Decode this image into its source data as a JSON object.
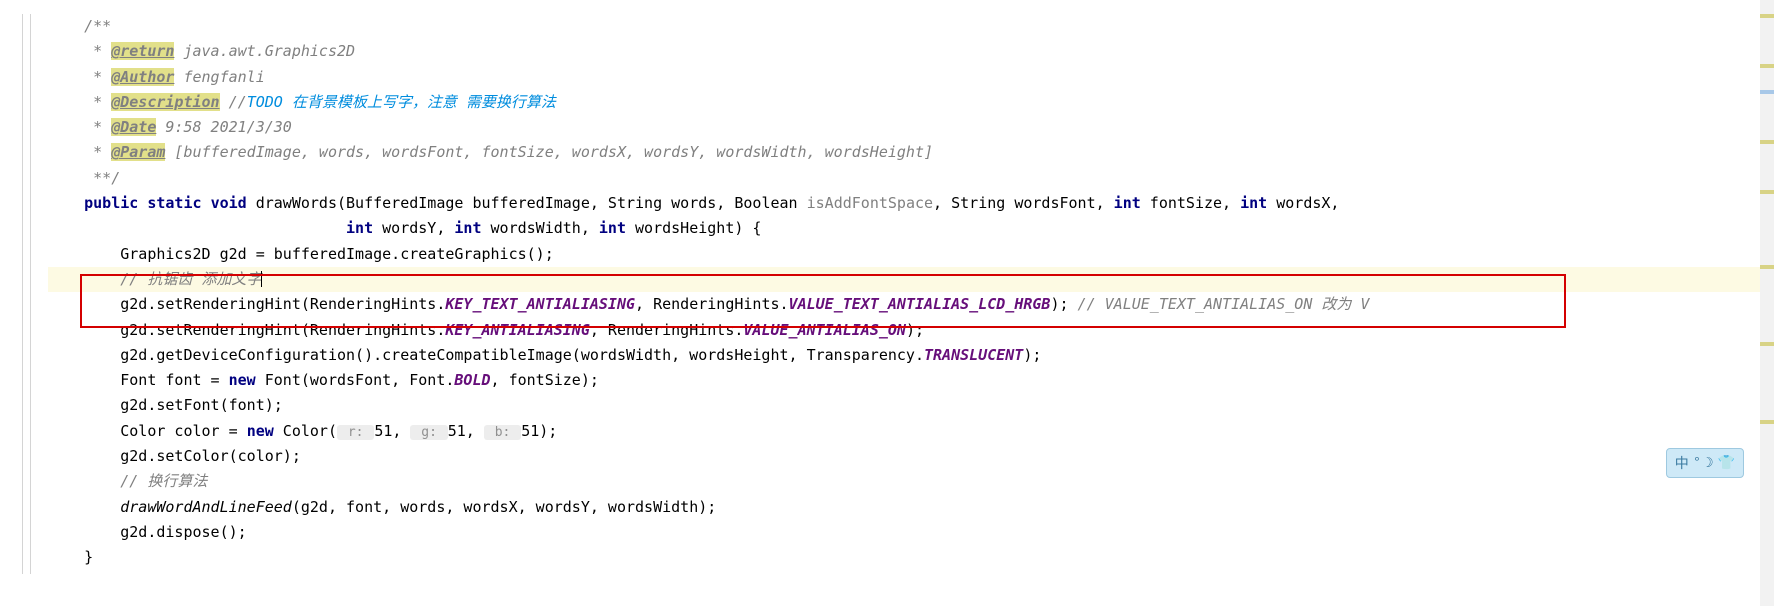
{
  "code": {
    "l0": "    /**",
    "l1_pre": "     * ",
    "l1_tag": "@return",
    "l1_val": " java.awt.Graphics2D",
    "l2_pre": "     * ",
    "l2_tag": "@Author",
    "l2_val": " fengfanli",
    "l3_pre": "     * ",
    "l3_tag": "@Description",
    "l3_slash": " //",
    "l3_todo": "TODO 在背景模板上写字，注意 需要换行算法",
    "l4_pre": "     * ",
    "l4_tag": "@Date",
    "l4_val": " 9:58 2021/3/30",
    "l5_pre": "     * ",
    "l5_tag": "@Param",
    "l5_val": " [bufferedImage, words, wordsFont, fontSize, wordsX, wordsY, wordsWidth, wordsHeight]",
    "l6": "     **/",
    "l7_a": "    ",
    "l7_public": "public",
    "l7_static": "static",
    "l7_void": "void",
    "l7_b": " drawWords(BufferedImage bufferedImage, String words, Boolean ",
    "l7_unused": "isAddFontSpace",
    "l7_c": ", String wordsFont, ",
    "l7_int1": "int",
    "l7_d": " fontSize, ",
    "l7_int2": "int",
    "l7_e": " wordsX,",
    "l8_indent": "                                 ",
    "l8_int1": "int",
    "l8_a": " wordsY, ",
    "l8_int2": "int",
    "l8_b": " wordsWidth, ",
    "l8_int3": "int",
    "l8_c": " wordsHeight) {",
    "l9": "        Graphics2D g2d = bufferedImage.createGraphics();",
    "l10_pre": "        ",
    "l10_comment": "// 抗锯齿 添加文字",
    "l11_a": "        g2d.setRenderingHint(RenderingHints.",
    "l11_key": "KEY_TEXT_ANTIALIASING",
    "l11_b": ", RenderingHints.",
    "l11_val": "VALUE_TEXT_ANTIALIAS_LCD_HRGB",
    "l11_c": "); ",
    "l11_comment": "// VALUE_TEXT_ANTIALIAS_ON 改为 V",
    "l12_a": "        g2d.setRenderingHint(RenderingHints.",
    "l12_key": "KEY_ANTIALIASING",
    "l12_b": ", RenderingHints.",
    "l12_val": "VALUE_ANTIALIAS_ON",
    "l12_c": ");",
    "l13_a": "        g2d.getDeviceConfiguration().createCompatibleImage(wordsWidth, wordsHeight, Transparency.",
    "l13_field": "TRANSLUCENT",
    "l13_b": ");",
    "l14_a": "        Font font = ",
    "l14_new": "new",
    "l14_b": " Font(wordsFont, Font.",
    "l14_field": "BOLD",
    "l14_c": ", fontSize);",
    "l15": "        g2d.setFont(font);",
    "l16_a": "        Color color = ",
    "l16_new": "new",
    "l16_b": " Color(",
    "l16_h1": " r: ",
    "l16_v1": "51, ",
    "l16_h2": " g: ",
    "l16_v2": "51, ",
    "l16_h3": " b: ",
    "l16_v3": "51);",
    "l17": "        g2d.setColor(color);",
    "l18_pre": "        ",
    "l18_comment": "// 换行算法",
    "l19_a": "        ",
    "l19_call": "drawWordAndLineFeed",
    "l19_b": "(g2d, font, words, wordsX, wordsY, wordsWidth);",
    "l20": "        g2d.dispose();",
    "l21": "    }"
  },
  "floating": {
    "char1": "中",
    "char2": "°",
    "char3": "☽",
    "char4": "👕"
  }
}
